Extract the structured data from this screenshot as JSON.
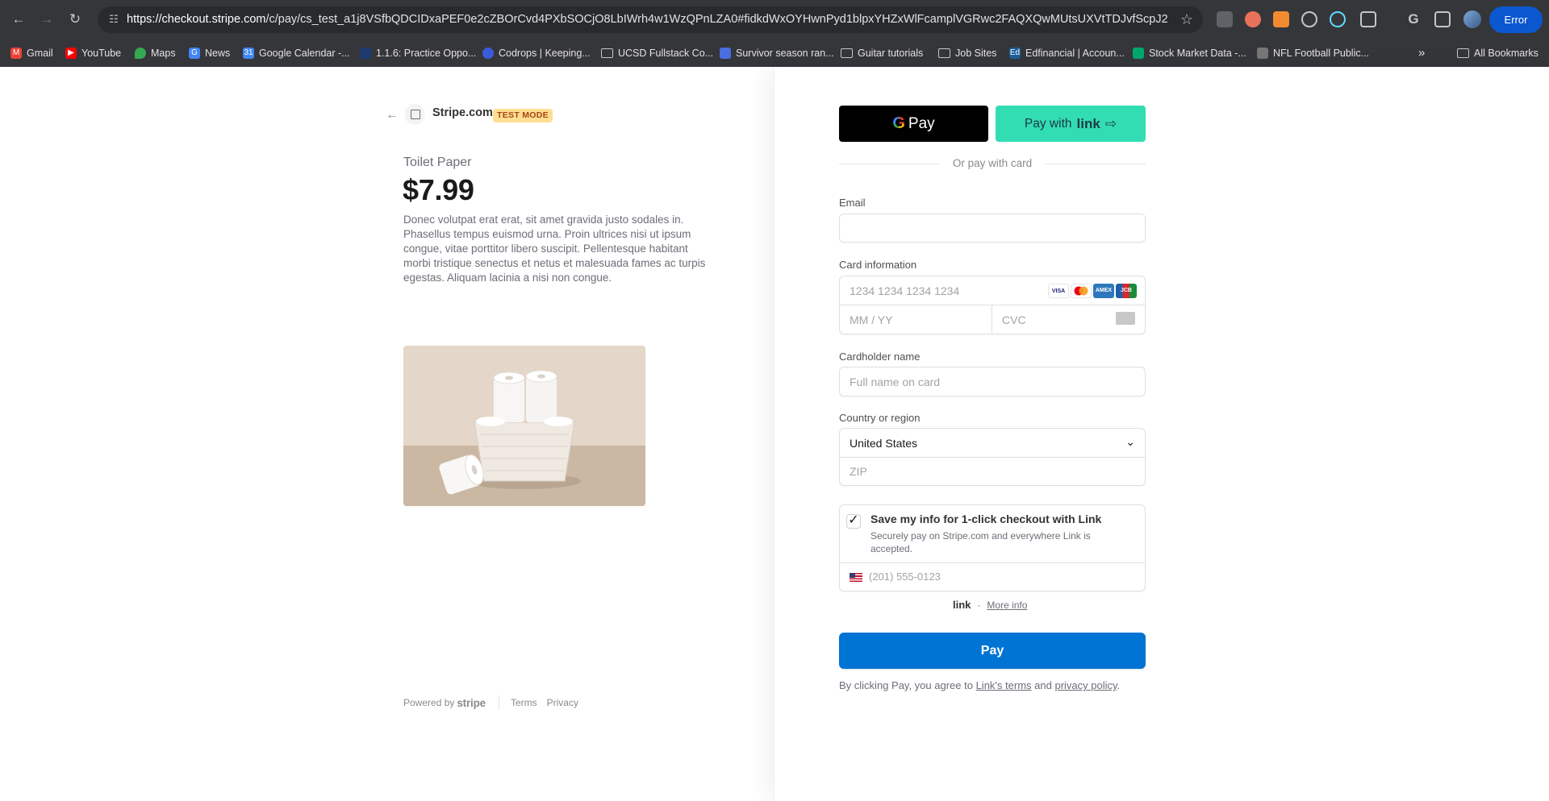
{
  "browser": {
    "url_domain": "https://checkout.stripe.com",
    "url_path": "/c/pay/cs_test_a1j8VSfbQDCIDxaPEF0e2cZBOrCvd4PXbSOCjO8LbIWrh4w1WzQPnLZA0#fidkdWxOYHwnPyd1blpxYHZxWlFcamplVGRwc2FAQXQwMUtsUXVtTDJvfScpJ2hsYXYnP34n...",
    "error_label": "Error",
    "bookmarks": [
      {
        "label": "Gmail",
        "icon": "gmail-icon",
        "color": "#ea4335"
      },
      {
        "label": "YouTube",
        "icon": "youtube-icon",
        "color": "#ff0000"
      },
      {
        "label": "Maps",
        "icon": "maps-icon",
        "color": "#34a853"
      },
      {
        "label": "News",
        "icon": "news-icon",
        "color": "#4285f4"
      },
      {
        "label": "Google Calendar -...",
        "icon": "calendar-icon",
        "color": "#4285f4"
      },
      {
        "label": "1.1.6: Practice Oppo...",
        "icon": "course-icon",
        "color": "#1f3a6e"
      },
      {
        "label": "Codrops | Keeping...",
        "icon": "codrops-icon",
        "color": "#3b5bdb"
      },
      {
        "label": "UCSD Fullstack Co...",
        "icon": "folder-icon",
        "color": ""
      },
      {
        "label": "Survivor season ran...",
        "icon": "sheets-icon",
        "color": "#4a6ee0"
      },
      {
        "label": "Guitar tutorials",
        "icon": "folder-icon",
        "color": ""
      },
      {
        "label": "Job Sites",
        "icon": "folder-icon",
        "color": ""
      },
      {
        "label": "Edfinancial | Accoun...",
        "icon": "edfinancial-icon",
        "color": "#1b5e9a"
      },
      {
        "label": "Stock Market Data -...",
        "icon": "stock-icon",
        "color": "#00a86b"
      },
      {
        "label": "NFL Football Public...",
        "icon": "nfl-icon",
        "color": "#777777"
      }
    ],
    "all_bookmarks_label": "All Bookmarks"
  },
  "left": {
    "merchant": "Stripe.com",
    "test_mode": "TEST MODE",
    "product_name": "Toilet Paper",
    "price": "$7.99",
    "description": "Donec volutpat erat erat, sit amet gravida justo sodales in. Phasellus tempus euismod urna. Proin ultrices nisi ut ipsum congue, vitae porttitor libero suscipit. Pellentesque habitant morbi tristique senectus et netus et malesuada fames ac turpis egestas. Aliquam lacinia a nisi non congue.",
    "powered_by": "Powered by",
    "stripe_word": "stripe",
    "terms": "Terms",
    "privacy": "Privacy"
  },
  "right": {
    "gpay_label": "Pay",
    "link_pay_prefix": "Pay with",
    "link_word": "link",
    "or_text": "Or pay with card",
    "email_label": "Email",
    "email_value": "",
    "card_label": "Card information",
    "card_number_placeholder": "1234 1234 1234 1234",
    "expiry_placeholder": "MM / YY",
    "cvc_placeholder": "CVC",
    "card_brands": [
      "VISA",
      "MC",
      "AMEX",
      "JCB"
    ],
    "cardholder_label": "Cardholder name",
    "cardholder_placeholder": "Full name on card",
    "country_label": "Country or region",
    "country_value": "United States",
    "zip_placeholder": "ZIP",
    "save_title": "Save my info for 1-click checkout with Link",
    "save_subtitle": "Securely pay on Stripe.com and everywhere Link is accepted.",
    "save_checked": true,
    "phone_placeholder": "(201) 555-0123",
    "link_footer_word": "link",
    "more_info": "More info",
    "pay_button": "Pay",
    "terms_prefix": "By clicking Pay, you agree to",
    "link_terms": "Link's terms",
    "and_word": "and",
    "privacy_policy": "privacy policy",
    "period": "."
  },
  "colors": {
    "pay_button": "#0074d4",
    "link_green": "#33ddb3",
    "test_badge_bg": "#ffde92",
    "test_badge_text": "#a2470c"
  }
}
